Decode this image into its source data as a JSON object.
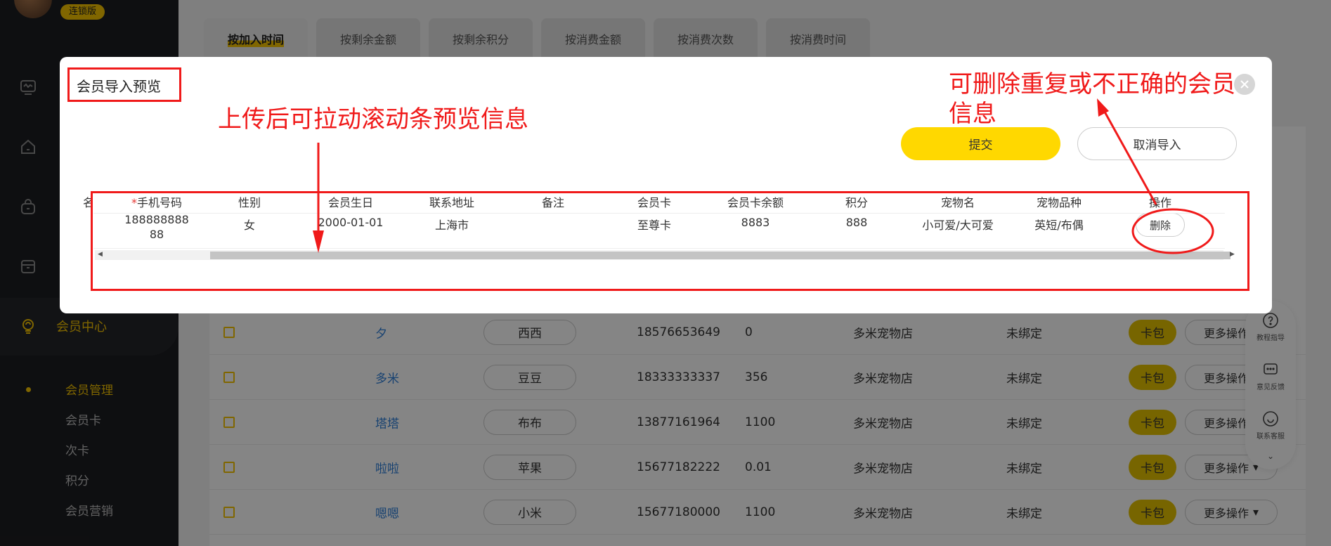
{
  "sidebar": {
    "badge": "连锁版",
    "member_center": "会员中心",
    "submenu": [
      "会员管理",
      "会员卡",
      "次卡",
      "积分",
      "会员营销"
    ]
  },
  "tabs": [
    "按加入时间",
    "按剩余金额",
    "按剩余积分",
    "按消费金额",
    "按消费次数",
    "按消费时间"
  ],
  "members": [
    {
      "name": "夕",
      "pet": "西西",
      "phone": "18576653649",
      "balance": "0",
      "shop": "多米宠物店",
      "bind": "未绑定"
    },
    {
      "name": "多米",
      "pet": "豆豆",
      "phone": "18333333337",
      "balance": "356",
      "shop": "多米宠物店",
      "bind": "未绑定"
    },
    {
      "name": "塔塔",
      "pet": "布布",
      "phone": "13877161964",
      "balance": "1100",
      "shop": "多米宠物店",
      "bind": "未绑定"
    },
    {
      "name": "啦啦",
      "pet": "苹果",
      "phone": "15677182222",
      "balance": "0.01",
      "shop": "多米宠物店",
      "bind": "未绑定"
    },
    {
      "name": "嗯嗯",
      "pet": "小米",
      "phone": "15677180000",
      "balance": "1100",
      "shop": "多米宠物店",
      "bind": "未绑定"
    }
  ],
  "row_actions": {
    "wallet": "卡包",
    "more": "更多操作"
  },
  "float_tools": [
    "教程指导",
    "意见反馈",
    "联系客服"
  ],
  "modal": {
    "title": "会员导入预览",
    "submit": "提交",
    "cancel": "取消导入",
    "headers": [
      "名",
      "*",
      "手机号码",
      "性别",
      "会员生日",
      "联系地址",
      "备注",
      "会员卡",
      "会员卡余额",
      "积分",
      "宠物名",
      "宠物品种",
      "操作"
    ],
    "row": {
      "phone_line1": "188888888",
      "phone_line2": "88",
      "gender": "女",
      "birthday": "2000-01-01",
      "address": "上海市",
      "note": "",
      "card": "至尊卡",
      "card_balance": "8883",
      "points": "888",
      "pet_name": "小可爱/大可爱",
      "pet_breed": "英短/布偶",
      "delete": "删除"
    }
  },
  "annotations": {
    "scroll_hint": "上传后可拉动滚动条预览信息",
    "delete_hint_line1": "可删除重复或不正确的会员",
    "delete_hint_line2": "信息"
  },
  "colors": {
    "accent": "#f5c400",
    "annotation": "#f01a1a",
    "link": "#2f7fd9",
    "sidebar_bg": "#1c1d21"
  }
}
